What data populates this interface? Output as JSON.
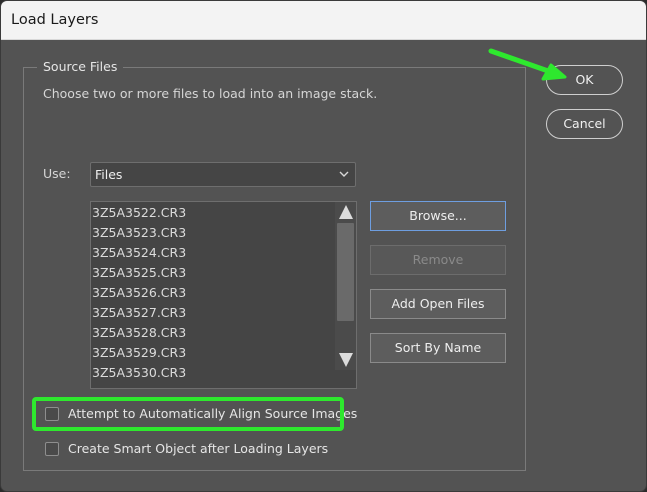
{
  "window": {
    "title": "Load Layers"
  },
  "group": {
    "legend": "Source Files",
    "instructions": "Choose two or more files to load into an image stack."
  },
  "use": {
    "label": "Use:",
    "selected": "Files"
  },
  "files": [
    "3Z5A3522.CR3",
    "3Z5A3523.CR3",
    "3Z5A3524.CR3",
    "3Z5A3525.CR3",
    "3Z5A3526.CR3",
    "3Z5A3527.CR3",
    "3Z5A3528.CR3",
    "3Z5A3529.CR3",
    "3Z5A3530.CR3"
  ],
  "buttons": {
    "ok": "OK",
    "cancel": "Cancel",
    "browse": "Browse...",
    "remove": "Remove",
    "add_open_files": "Add Open Files",
    "sort_by_name": "Sort By Name"
  },
  "options": {
    "align": {
      "label": "Attempt to Automatically Align Source Images",
      "checked": false
    },
    "smart_object": {
      "label": "Create Smart Object after Loading Layers",
      "checked": false
    }
  },
  "annotation": {
    "color": "#2ee82e"
  },
  "icons": {
    "dropdown": "chevron-down-icon",
    "scroll_up": "triangle-up-icon",
    "scroll_down": "triangle-down-icon",
    "pointer": "green-arrow-icon"
  }
}
